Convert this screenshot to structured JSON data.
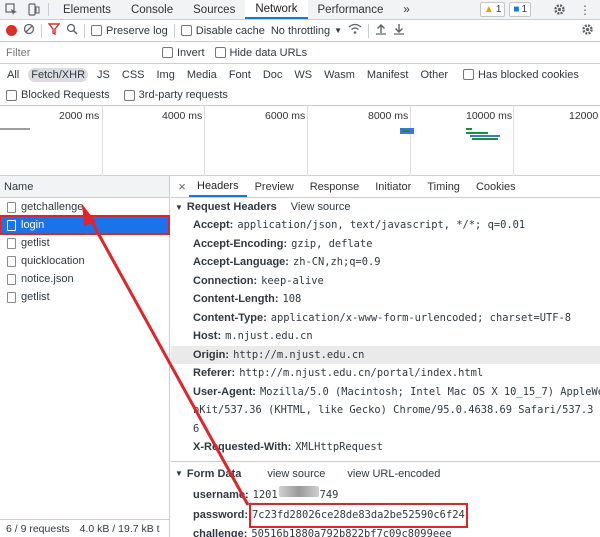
{
  "tabs": [
    {
      "label": "Elements"
    },
    {
      "label": "Console"
    },
    {
      "label": "Sources"
    },
    {
      "label": "Network"
    },
    {
      "label": "Performance"
    }
  ],
  "more_tabs": "»",
  "warnings_count": "1",
  "messages_count": "1",
  "toolbar": {
    "preserve_log": "Preserve log",
    "disable_cache": "Disable cache",
    "throttling": "No throttling"
  },
  "filter": {
    "placeholder": "Filter",
    "invert": "Invert",
    "hide_data_urls": "Hide data URLs"
  },
  "types": [
    "All",
    "Fetch/XHR",
    "JS",
    "CSS",
    "Img",
    "Media",
    "Font",
    "Doc",
    "WS",
    "Wasm",
    "Manifest",
    "Other"
  ],
  "active_type": "Fetch/XHR",
  "has_blocked_cookies": "Has blocked cookies",
  "blocked_requests": "Blocked Requests",
  "third_party": "3rd-party requests",
  "timeline_ticks": [
    "2000 ms",
    "4000 ms",
    "6000 ms",
    "8000 ms",
    "10000 ms",
    "12000"
  ],
  "list": {
    "header": "Name",
    "rows": [
      {
        "name": "getchallenge"
      },
      {
        "name": "login"
      },
      {
        "name": "getlist"
      },
      {
        "name": "quicklocation"
      },
      {
        "name": "notice.json"
      },
      {
        "name": "getlist"
      }
    ],
    "selected_index": 1,
    "status_requests": "6 / 9 requests",
    "status_size": "4.0 kB / 19.7 kB t"
  },
  "detail_tabs": [
    "Headers",
    "Preview",
    "Response",
    "Initiator",
    "Timing",
    "Cookies"
  ],
  "active_detail_tab": "Headers",
  "request_headers": {
    "title": "Request Headers",
    "view_source": "View source",
    "items": [
      {
        "key": "Accept:",
        "value": "application/json, text/javascript, */*; q=0.01"
      },
      {
        "key": "Accept-Encoding:",
        "value": "gzip, deflate"
      },
      {
        "key": "Accept-Language:",
        "value": "zh-CN,zh;q=0.9"
      },
      {
        "key": "Connection:",
        "value": "keep-alive"
      },
      {
        "key": "Content-Length:",
        "value": "108"
      },
      {
        "key": "Content-Type:",
        "value": "application/x-www-form-urlencoded; charset=UTF-8"
      },
      {
        "key": "Host:",
        "value": "m.njust.edu.cn"
      },
      {
        "key": "Origin:",
        "value": "http://m.njust.edu.cn"
      },
      {
        "key": "Referer:",
        "value": "http://m.njust.edu.cn/portal/index.html"
      },
      {
        "key": "User-Agent:",
        "value": "Mozilla/5.0 (Macintosh; Intel Mac OS X 10_15_7) AppleWe"
      }
    ],
    "user_agent_cont_1": "bKit/537.36 (KHTML, like Gecko) Chrome/95.0.4638.69 Safari/537.3",
    "user_agent_cont_2": "6",
    "requested_with_key": "X-Requested-With:",
    "requested_with_value": "XMLHttpRequest"
  },
  "form_data": {
    "title": "Form Data",
    "view_source": "view source",
    "view_url_encoded": "view URL-encoded",
    "username_key": "username:",
    "username_prefix": "1201",
    "username_suffix": "749",
    "password_key": "password:",
    "password_value": "7c23fd28026ce28de83da2be52590c6f24",
    "challenge_key": "challenge:",
    "challenge_value": "50516b1880a792b822bf7c09c8099eee"
  },
  "colors": {
    "accent": "#1a73e8",
    "annotation_red": "#e0242a",
    "record_red": "#d93025"
  }
}
